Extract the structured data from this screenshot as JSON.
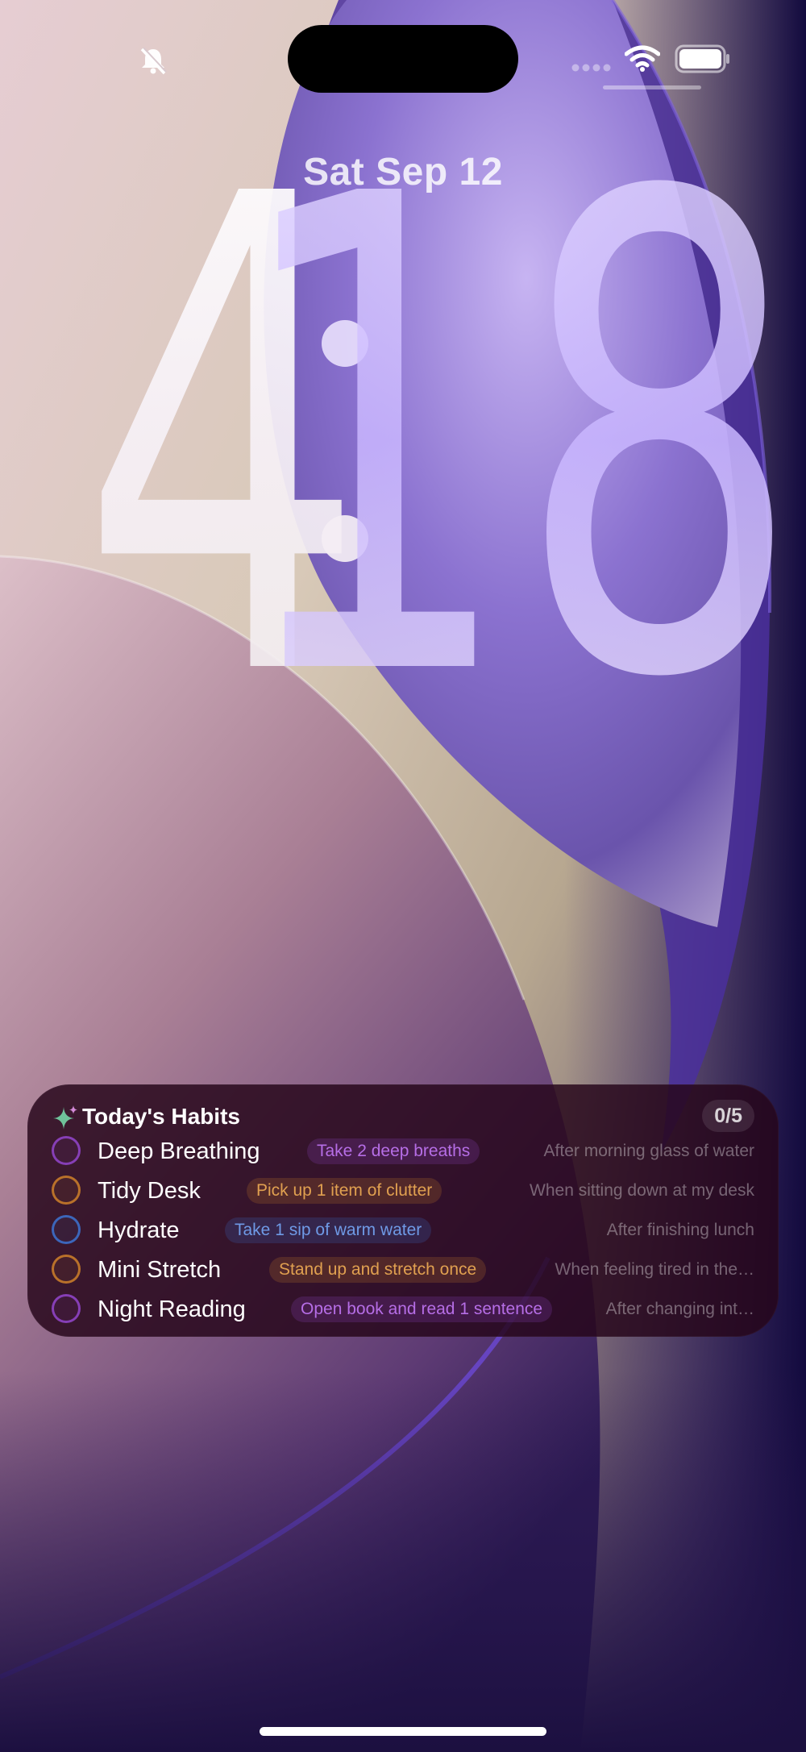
{
  "status_bar": {
    "silent_icon": "bell-slash-icon",
    "signal_icon": "cellular-signal-icon",
    "wifi_icon": "wifi-icon",
    "battery_icon": "battery-icon"
  },
  "lock_screen": {
    "date": "Sat Sep 12",
    "time_hours": "4",
    "time_minutes": "18"
  },
  "widget": {
    "icon": "sparkles-icon",
    "title": "Today's Habits",
    "progress": "0/5",
    "habits": [
      {
        "name": "Deep Breathing",
        "action": "Take 2 deep breaths",
        "cue": "After morning glass of water",
        "color": "#8e44c4",
        "completed": false
      },
      {
        "name": "Tidy Desk",
        "action": "Pick up 1 item of clutter",
        "cue": "When sitting down at my desk",
        "color": "#c67a2a",
        "completed": false
      },
      {
        "name": "Hydrate",
        "action": "Take 1 sip of warm water",
        "cue": "After finishing lunch",
        "color": "#3d6fc9",
        "completed": false
      },
      {
        "name": "Mini Stretch",
        "action": "Stand up and stretch once",
        "cue": "When feeling tired in the…",
        "color": "#c67a2a",
        "completed": false
      },
      {
        "name": "Night Reading",
        "action": "Open book and read 1 sentence",
        "cue": "After changing int…",
        "color": "#8e44c4",
        "completed": false
      }
    ]
  },
  "colors": {
    "purple_accent": "#8e44c4",
    "orange_accent": "#c67a2a",
    "blue_accent": "#3d6fc9"
  }
}
